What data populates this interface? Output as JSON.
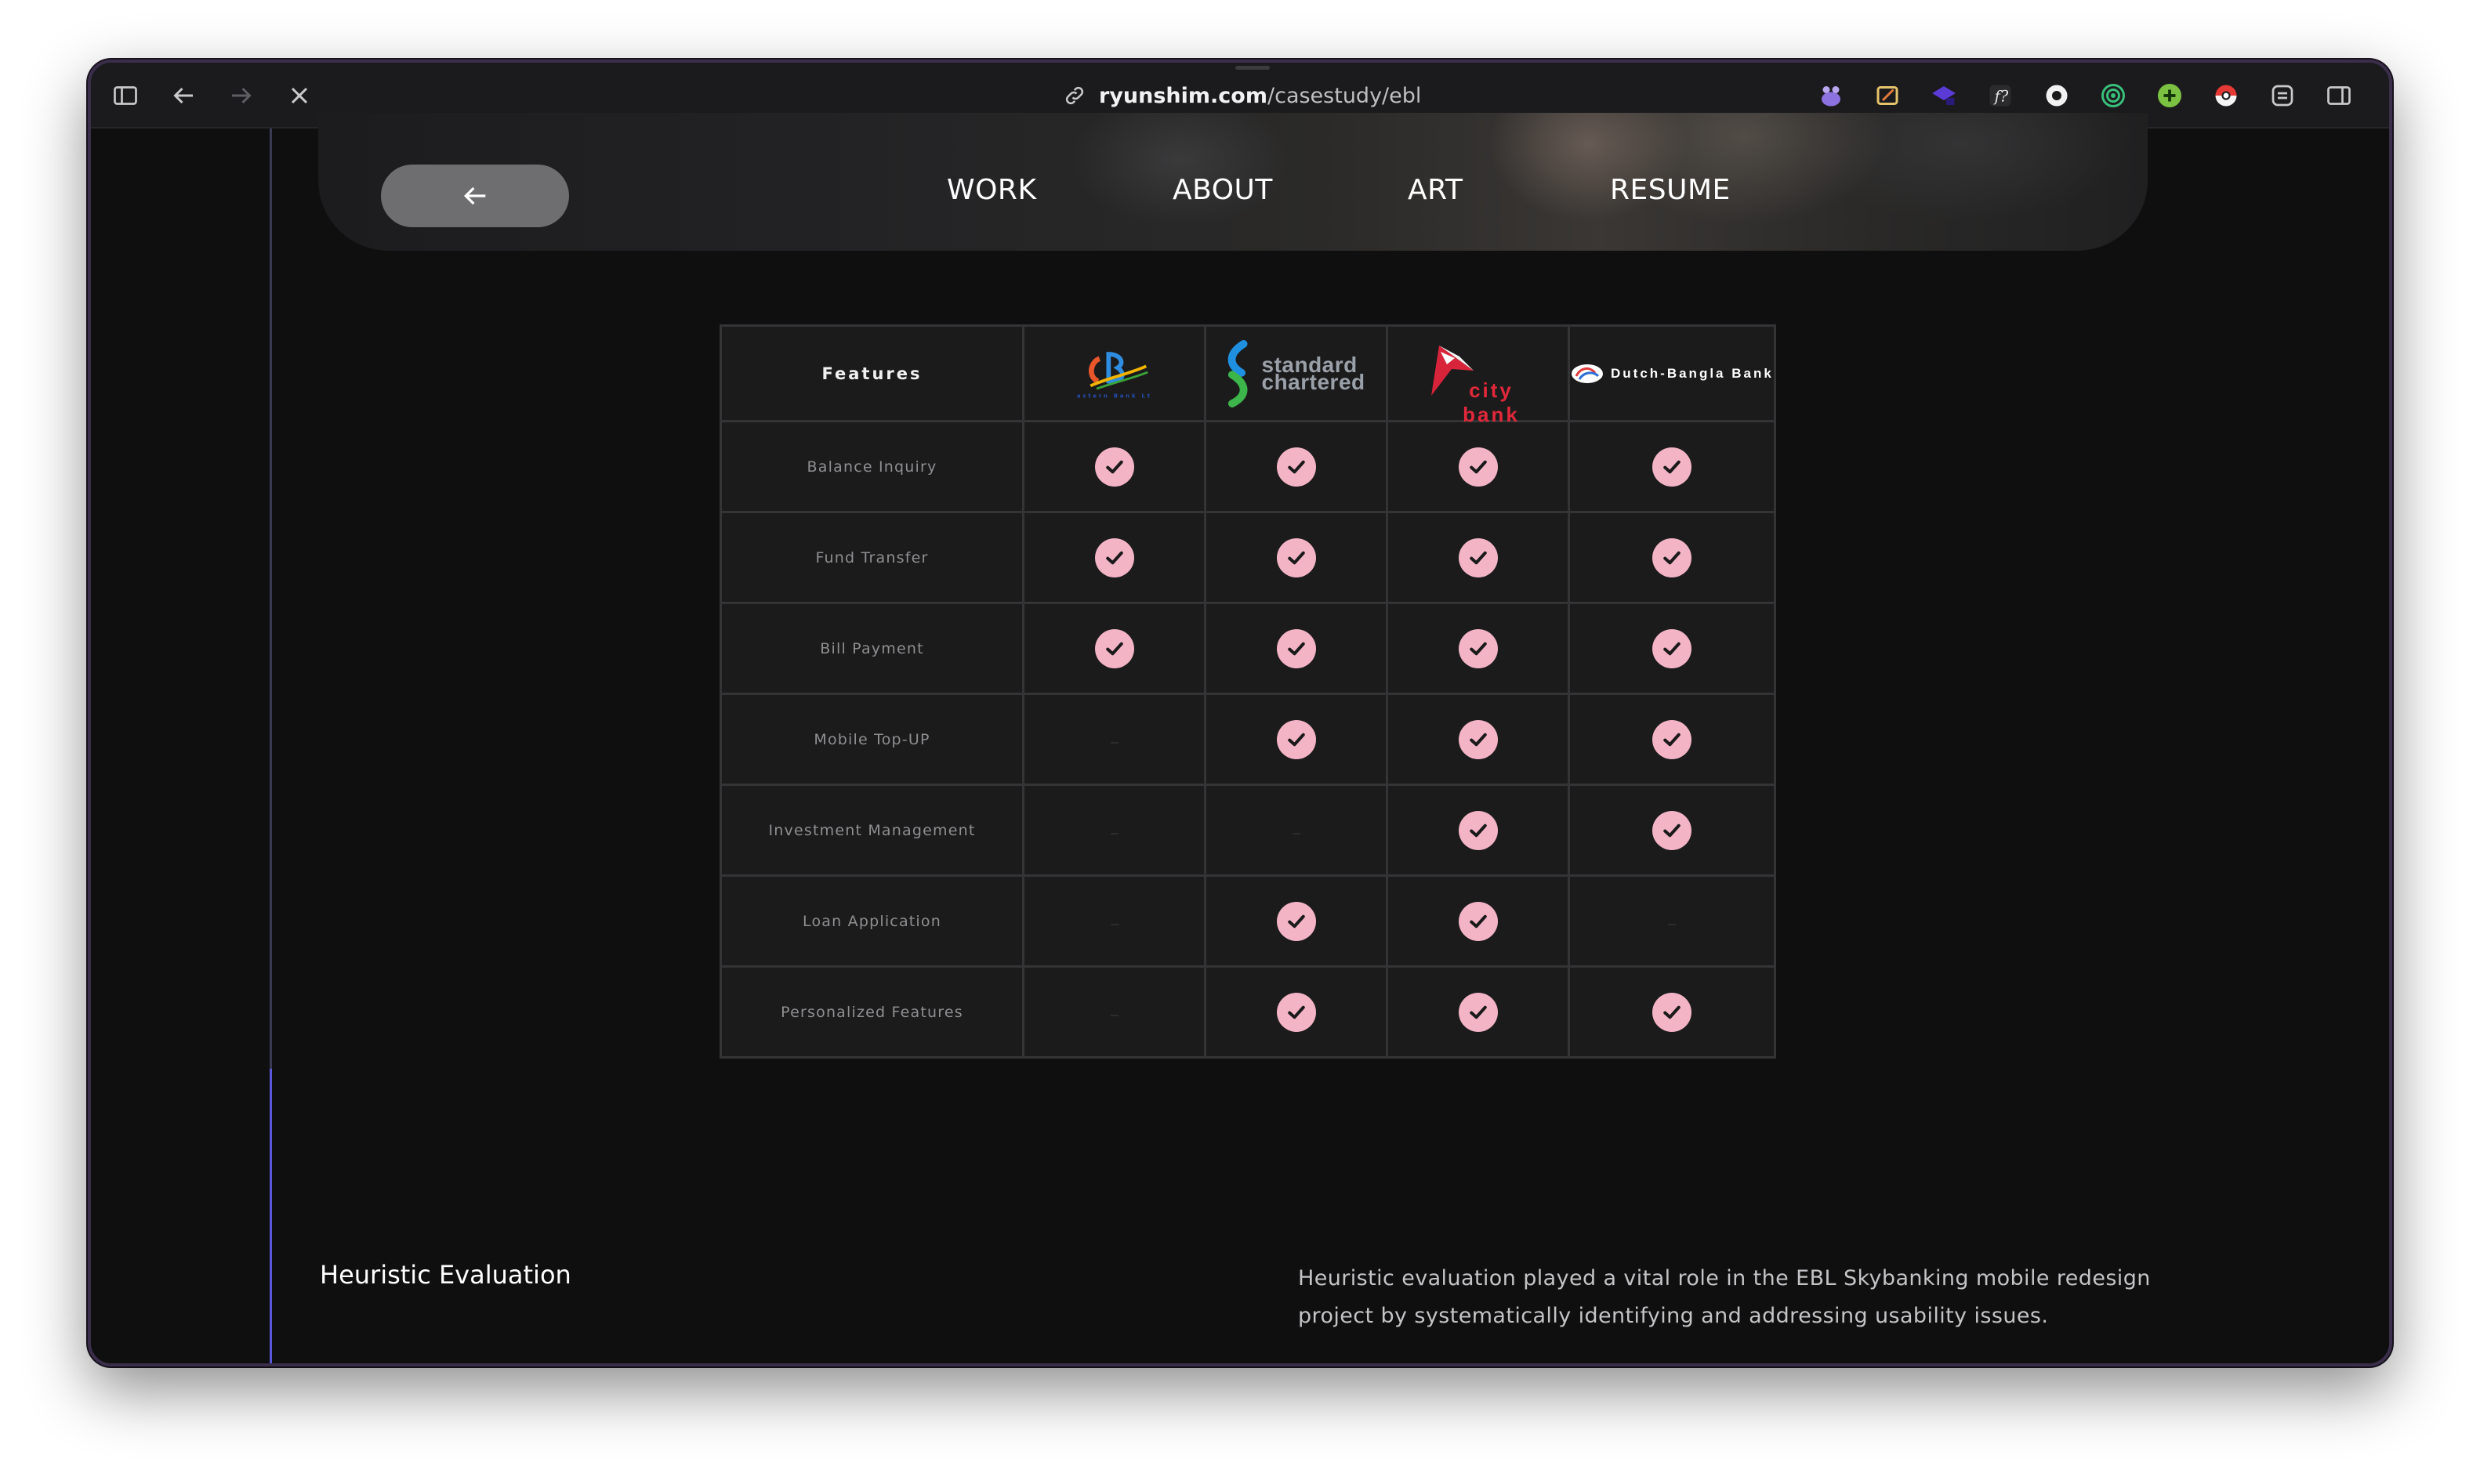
{
  "browser": {
    "url_host": "ryunshim.com",
    "url_path": "/casestudy/ebl"
  },
  "nav": {
    "links": [
      "WORK",
      "ABOUT",
      "ART",
      "RESUME"
    ]
  },
  "table": {
    "header": "Features",
    "banks": [
      {
        "name": "Eastern Bank Ltd",
        "logo_text": "Eastern Bank Ltd"
      },
      {
        "name": "Standard Chartered",
        "logo_text": "standard chartered"
      },
      {
        "name": "City Bank",
        "logo_text": "city bank"
      },
      {
        "name": "Dutch-Bangla Bank",
        "logo_text": "Dutch-Bangla Bank"
      }
    ],
    "rows": [
      {
        "feature": "Balance Inquiry",
        "support": [
          true,
          true,
          true,
          true
        ]
      },
      {
        "feature": "Fund Transfer",
        "support": [
          true,
          true,
          true,
          true
        ]
      },
      {
        "feature": "Bill Payment",
        "support": [
          true,
          true,
          true,
          true
        ]
      },
      {
        "feature": "Mobile Top-UP",
        "support": [
          false,
          true,
          true,
          true
        ]
      },
      {
        "feature": "Investment Management",
        "support": [
          false,
          false,
          true,
          true
        ]
      },
      {
        "feature": "Loan Application",
        "support": [
          false,
          true,
          true,
          false
        ]
      },
      {
        "feature": "Personalized Features",
        "support": [
          false,
          true,
          true,
          true
        ]
      }
    ],
    "check_color": "#f3b4c6"
  },
  "section": {
    "title": "Heuristic Evaluation",
    "body": "Heuristic evaluation played a vital role in the EBL Skybanking mobile redesign project by systematically identifying and addressing usability issues."
  },
  "colors": {
    "background": "#0f0f10",
    "accent_rule": "#5a57d8"
  }
}
